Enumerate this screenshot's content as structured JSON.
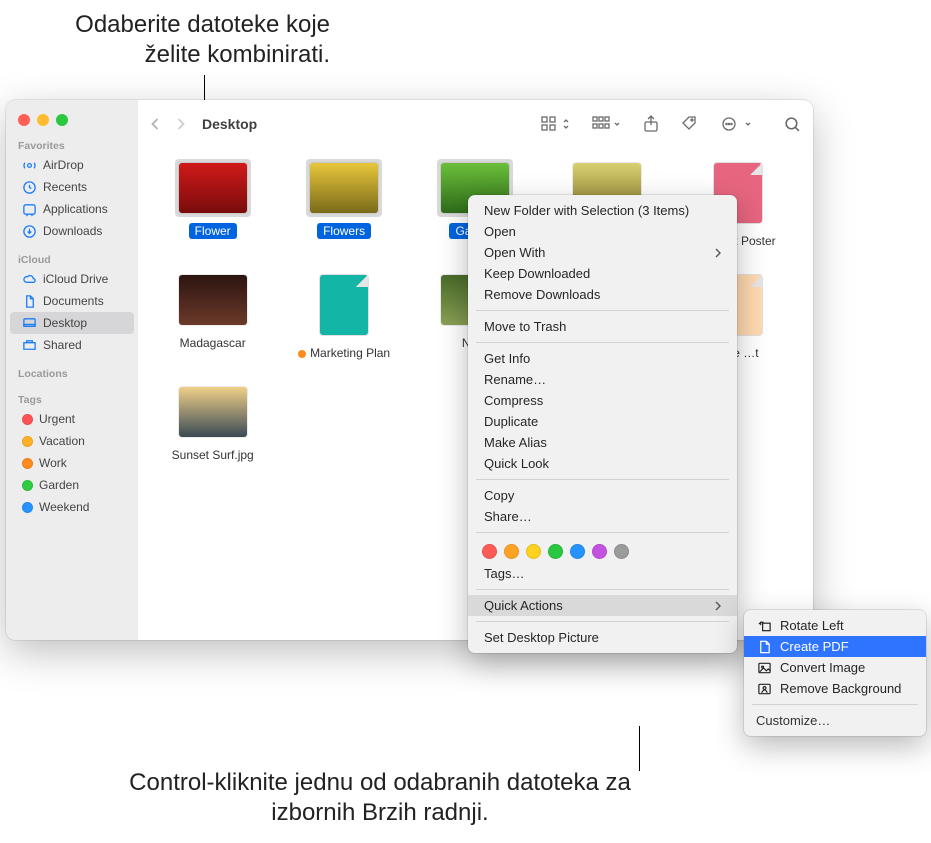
{
  "callouts": {
    "top": "Odaberite datoteke koje želite kombinirati.",
    "bottom": "Control-kliknite jednu od odabranih datoteka za izbornih Brzih radnji."
  },
  "toolbar": {
    "title": "Desktop"
  },
  "sidebar": {
    "sections": {
      "favorites": {
        "label": "Favorites",
        "items": [
          "AirDrop",
          "Recents",
          "Applications",
          "Downloads"
        ]
      },
      "icloud": {
        "label": "iCloud",
        "items": [
          "iCloud Drive",
          "Documents",
          "Desktop",
          "Shared"
        ]
      },
      "locations": {
        "label": "Locations"
      },
      "tags": {
        "label": "Tags",
        "items": [
          {
            "label": "Urgent",
            "color": "#ff5257"
          },
          {
            "label": "Vacation",
            "color": "#ffb026"
          },
          {
            "label": "Work",
            "color": "#ff8a1e"
          },
          {
            "label": "Garden",
            "color": "#2ecc40"
          },
          {
            "label": "Weekend",
            "color": "#2693ff"
          }
        ]
      }
    }
  },
  "files": [
    {
      "label": "Flower",
      "selected": true,
      "kind": "img",
      "bg": "linear-gradient(#d11919,#7a0c0c)"
    },
    {
      "label": "Flowers",
      "selected": true,
      "kind": "img",
      "bg": "linear-gradient(#e8c63a,#7a6b1a)"
    },
    {
      "label": "Garden",
      "selected": true,
      "kind": "img",
      "bg": "linear-gradient(#6bbf3a,#2f6b1a)"
    },
    {
      "label": "",
      "selected": false,
      "kind": "img",
      "bg": "linear-gradient(#d8d070,#8a7a30)"
    },
    {
      "label": "Market Poster",
      "selected": false,
      "kind": "paper",
      "bg": "#e7657f"
    },
    {
      "label": "Madagascar",
      "selected": false,
      "kind": "img",
      "bg": "linear-gradient(#2c1410,#6b3a2a)"
    },
    {
      "label": "Marketing Plan",
      "selected": false,
      "kind": "paper",
      "bg": "#12b5a6",
      "dot": "#ff8a1e"
    },
    {
      "label": "Na…",
      "selected": false,
      "kind": "img",
      "bg": "linear-gradient(#4a6b2a,#8aa055)"
    },
    {
      "label": "",
      "selected": false,
      "kind": "paper",
      "bg": "#fff"
    },
    {
      "label": "…te …t",
      "selected": false,
      "kind": "paper",
      "bg": "#ffd9b0"
    },
    {
      "label": "Sunset Surf.jpg",
      "selected": false,
      "kind": "img",
      "bg": "linear-gradient(#f0d088,#3a4a55)"
    }
  ],
  "context_menu": {
    "items": [
      "New Folder with Selection (3 Items)",
      "Open",
      "Open With",
      "Keep Downloaded",
      "Remove Downloads",
      "—",
      "Move to Trash",
      "—",
      "Get Info",
      "Rename…",
      "Compress",
      "Duplicate",
      "Make Alias",
      "Quick Look",
      "—",
      "Copy",
      "Share…",
      "—",
      "TAGS",
      "Tags…",
      "—",
      "Quick Actions",
      "—",
      "Set Desktop Picture"
    ],
    "tag_colors": [
      "#ff5b56",
      "#ffa325",
      "#ffd21f",
      "#28c840",
      "#2693ff",
      "#c452e0",
      "#9b9b9b"
    ]
  },
  "submenu": {
    "items": [
      {
        "label": "Rotate Left",
        "highlight": false
      },
      {
        "label": "Create PDF",
        "highlight": true
      },
      {
        "label": "Convert Image",
        "highlight": false
      },
      {
        "label": "Remove Background",
        "highlight": false
      }
    ],
    "footer": "Customize…"
  }
}
